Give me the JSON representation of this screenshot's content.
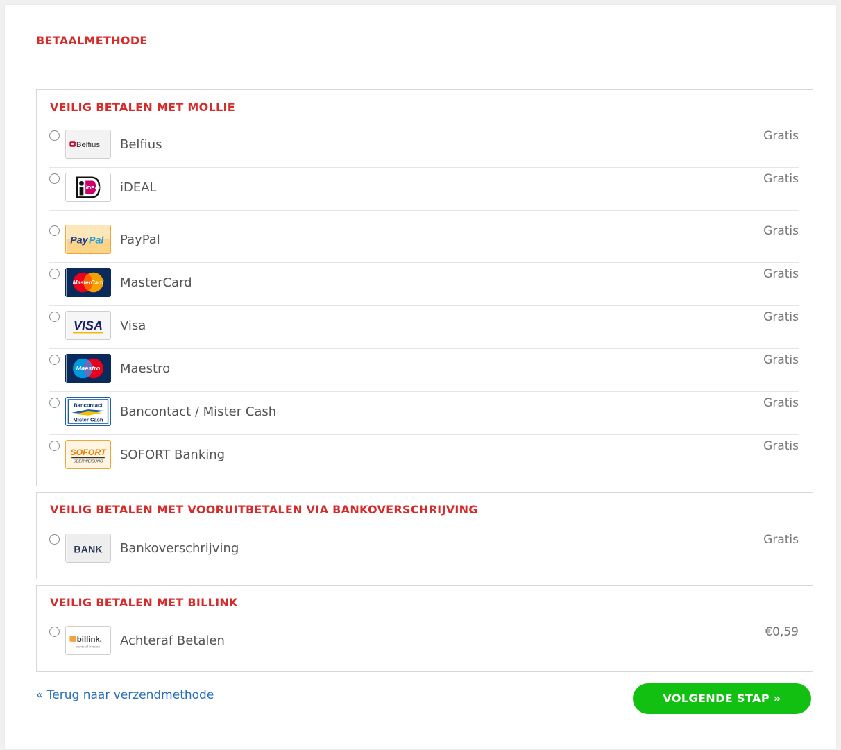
{
  "page_title": "BETAALMETHODE",
  "groups": [
    {
      "title": "VEILIG BETALEN MET MOLLIE",
      "methods": [
        {
          "name": "Belfius",
          "price": "Gratis",
          "icon": "belfius-logo"
        },
        {
          "name": "iDEAL",
          "price": "Gratis",
          "icon": "ideal-logo"
        },
        {
          "name": "PayPal",
          "price": "Gratis",
          "icon": "paypal-logo"
        },
        {
          "name": "MasterCard",
          "price": "Gratis",
          "icon": "mastercard-logo"
        },
        {
          "name": "Visa",
          "price": "Gratis",
          "icon": "visa-logo"
        },
        {
          "name": "Maestro",
          "price": "Gratis",
          "icon": "maestro-logo"
        },
        {
          "name": "Bancontact / Mister Cash",
          "price": "Gratis",
          "icon": "bancontact-logo"
        },
        {
          "name": "SOFORT Banking",
          "price": "Gratis",
          "icon": "sofort-logo"
        }
      ]
    },
    {
      "title": "VEILIG BETALEN MET VOORUITBETALEN VIA BANKOVERSCHRIJVING",
      "methods": [
        {
          "name": "Bankoverschrijving",
          "price": "Gratis",
          "icon": "bank-logo"
        }
      ]
    },
    {
      "title": "VEILIG BETALEN MET BILLINK",
      "methods": [
        {
          "name": "Achteraf Betalen",
          "price": "€0,59",
          "icon": "billink-logo"
        }
      ]
    }
  ],
  "logos": {
    "belfius": "Belfius",
    "ideal": "iDEAL",
    "paypal_pay": "Pay",
    "paypal_pal": "Pal",
    "mastercard": "MasterCard",
    "visa": "VISA",
    "maestro": "Maestro",
    "bancontact_top": "Bancontact",
    "bancontact_bottom": "Mister Cash",
    "sofort_top": "SOFORT",
    "sofort_bottom": "ÜBERWEISUNG",
    "bank": "BANK",
    "billink": "billink.",
    "billink_sub": "achteraf betalen"
  },
  "footer": {
    "back_link": "« Terug naar verzendmethode",
    "next_button": "VOLGENDE STAP »"
  },
  "colors": {
    "heading_red": "#d62b2b",
    "link_blue": "#2a6fb8",
    "button_green": "#12c012",
    "price_grey": "#777777"
  }
}
